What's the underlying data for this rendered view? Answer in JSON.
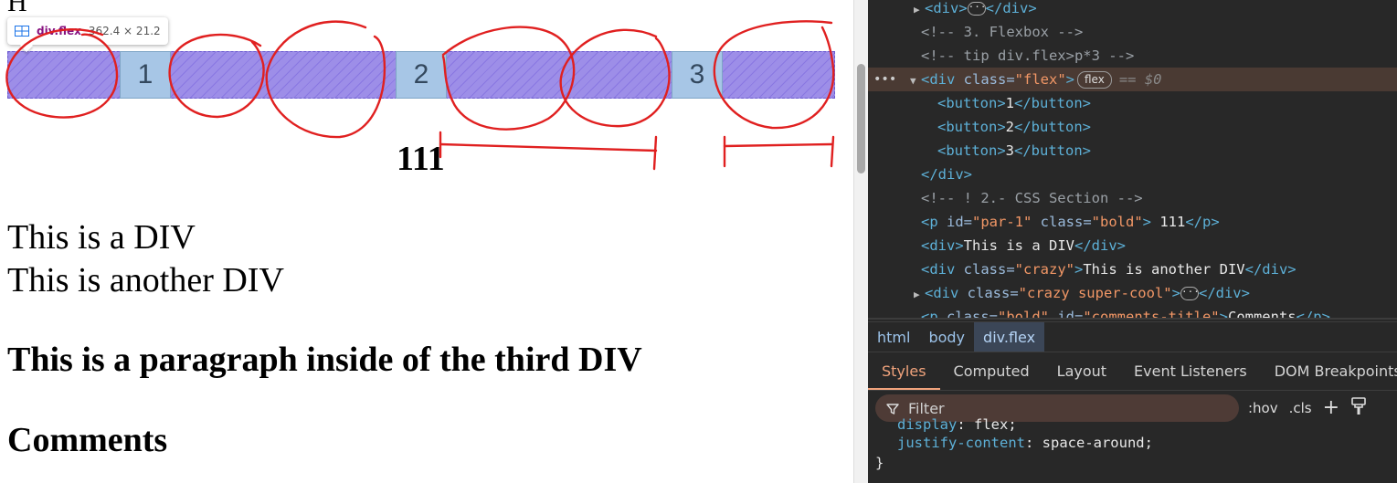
{
  "page": {
    "top_fragment": "H",
    "buttons": [
      "1",
      "2",
      "3"
    ],
    "tooltip": {
      "name": "div.flex",
      "size": "362.4 × 21.2"
    },
    "par_text": "111",
    "div_text_1": "This is a DIV",
    "div_text_2": "This is another DIV",
    "third_div_paragraph": "This is a paragraph inside of the third DIV",
    "comments_title": "Comments"
  },
  "colors": {
    "flex_overlay": "#9d8ee8",
    "button_bg": "#a7c6e6",
    "annotation": "#e02020",
    "devtools_bg": "#282828",
    "tag": "#5db0d7",
    "attr_value": "#f29766",
    "active_tab": "#f0a37c"
  },
  "dom": {
    "line1": {
      "open": "<div>",
      "close": "</div>"
    },
    "comment1": "<!-- 3. Flexbox -->",
    "comment2": "<!-- tip div.flex>p*3 -->",
    "flex_line": {
      "open": "<div",
      "attr": " class=",
      "value": "\"flex\"",
      "end": ">",
      "badge": "flex",
      "eq": "== $0"
    },
    "buttons": [
      {
        "open": "<button>",
        "text": "1",
        "close": "</button>"
      },
      {
        "open": "<button>",
        "text": "2",
        "close": "</button>"
      },
      {
        "open": "<button>",
        "text": "3",
        "close": "</button>"
      }
    ],
    "close_div": "</div>",
    "comment3": "<!-- ! 2.- CSS Section -->",
    "p_line": {
      "open": "<p",
      "attr1": " id=",
      "val1": "\"par-1\"",
      "attr2": " class=",
      "val2": "\"bold\"",
      "end": ">",
      "text": " 111",
      "close": "</p>"
    },
    "div_line": {
      "open": "<div>",
      "text": "This is a DIV",
      "close": "</div>"
    },
    "crazy_line": {
      "open": "<div",
      "attr": " class=",
      "value": "\"crazy\"",
      "end": ">",
      "text": "This is another DIV",
      "close": "</div>"
    },
    "supercool_line": {
      "open": "<div",
      "attr": " class=",
      "value": "\"crazy super-cool\"",
      "end": ">",
      "close": "</div>"
    },
    "cut_line": {
      "open": "<p",
      "attr1": " class=",
      "val1": "\"bold\"",
      "attr2": " id=",
      "val2": "\"comments-title\"",
      "end": ">",
      "text": "Comments",
      "close": "</p>"
    }
  },
  "breadcrumb": [
    "html",
    "body",
    "div.flex"
  ],
  "style_tabs": [
    "Styles",
    "Computed",
    "Layout",
    "Event Listeners",
    "DOM Breakpoints"
  ],
  "filter": {
    "placeholder": "Filter",
    "hov": ":hov",
    "cls": ".cls",
    "plus": "+"
  },
  "css": {
    "partial_prop": "display",
    "partial_value": "flex;",
    "prop": "justify-content",
    "value": "space-around;",
    "close": "}"
  },
  "icons": [
    "flex-layout-icon",
    "filter-icon",
    "add-rule-icon",
    "paint-brush-icon",
    "expand-triangle-icon",
    "ellipsis-icon"
  ]
}
